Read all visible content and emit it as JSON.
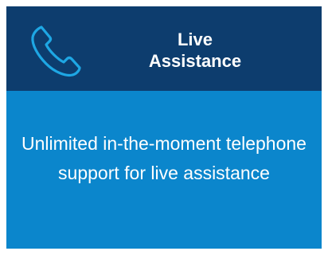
{
  "card": {
    "icon": "phone-icon",
    "title_line1": "Live",
    "title_line2": "Assistance",
    "description": "Unlimited in-the-moment telephone support for live assistance",
    "colors": {
      "header_bg": "#0d3d6e",
      "body_bg": "#0b86cc",
      "icon_stroke": "#1ea7e4",
      "text": "#ffffff"
    }
  }
}
